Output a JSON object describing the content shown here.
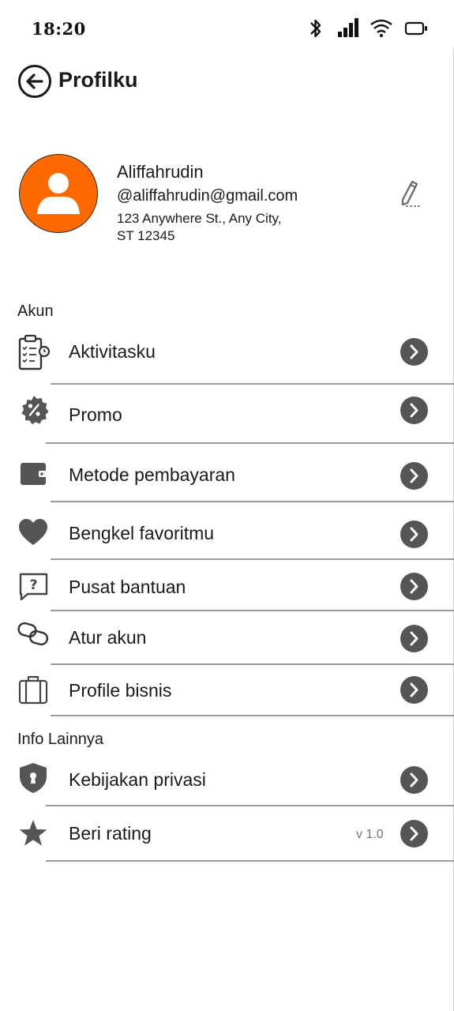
{
  "status_bar": {
    "time": "18:20",
    "icons": [
      "bluetooth-icon",
      "signal-icon",
      "wifi-icon",
      "battery-icon"
    ]
  },
  "header": {
    "back_icon": "arrow-left-icon",
    "title": "Profilku"
  },
  "profile": {
    "name": "Aliffahrudin",
    "email": "@aliffahrudin@gmail.com",
    "address_line1": "123 Anywhere St., Any City,",
    "address_line2": "ST 12345",
    "avatar_color": "#ff6a00",
    "edit_icon": "pencil-icon"
  },
  "sections": {
    "account_label": "Akun",
    "other_label": "Info Lainnya"
  },
  "menu": {
    "aktivitasku": "Aktivitasku",
    "promo": "Promo",
    "metode": "Metode pembayaran",
    "bengkel": "Bengkel favoritmu",
    "bantuan": "Pusat bantuan",
    "atur": "Atur akun",
    "bisnis": "Profile bisnis",
    "privasi": "Kebijakan privasi",
    "rating": "Beri rating",
    "rating_version": "v 1.0"
  },
  "colors": {
    "chevron_bg": "#555555",
    "icon_fill": "#555555",
    "accent": "#ff6a00"
  }
}
